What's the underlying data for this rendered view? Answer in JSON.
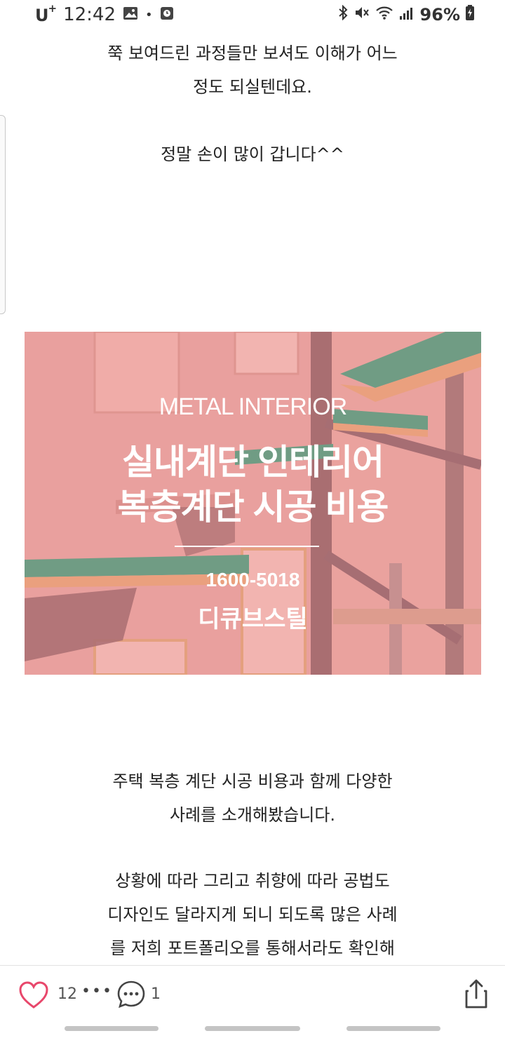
{
  "status_bar": {
    "carrier": "U",
    "carrier_plus": "+",
    "time": "12:42",
    "dot": "•",
    "battery_pct": "96%",
    "icons": [
      "gallery-icon",
      "alarm-icon",
      "bluetooth-icon",
      "mute-icon",
      "wifi-icon",
      "signal-icon",
      "battery-charging-icon"
    ]
  },
  "article": {
    "para1": [
      "쭉 보여드린 과정들만 보셔도 이해가 어느",
      "정도 되실텐데요."
    ],
    "para2": [
      "정말 손이 많이 갑니다^^"
    ],
    "banner": {
      "subtitle": "METAL INTERIOR",
      "title_line1": "실내계단 인테리어",
      "title_line2": "복층계단 시공 비용",
      "phone": "1600-5018",
      "brand": "디큐브스틸"
    },
    "para3": [
      "주택 복층 계단 시공 비용과 함께 다양한",
      "사례를 소개해봤습니다."
    ],
    "para4": [
      "상황에 따라 그리고 취향에 따라 공법도",
      "디자인도 달라지게 되니 되도록 많은 사례",
      "를 저희 포트폴리오를 통해서라도 확인해"
    ]
  },
  "action_bar": {
    "like_count": "12",
    "likers_more": "•••",
    "comment_count": "1"
  },
  "colors": {
    "like_accent": "#e8476b",
    "banner_tint": "#e79a95"
  }
}
